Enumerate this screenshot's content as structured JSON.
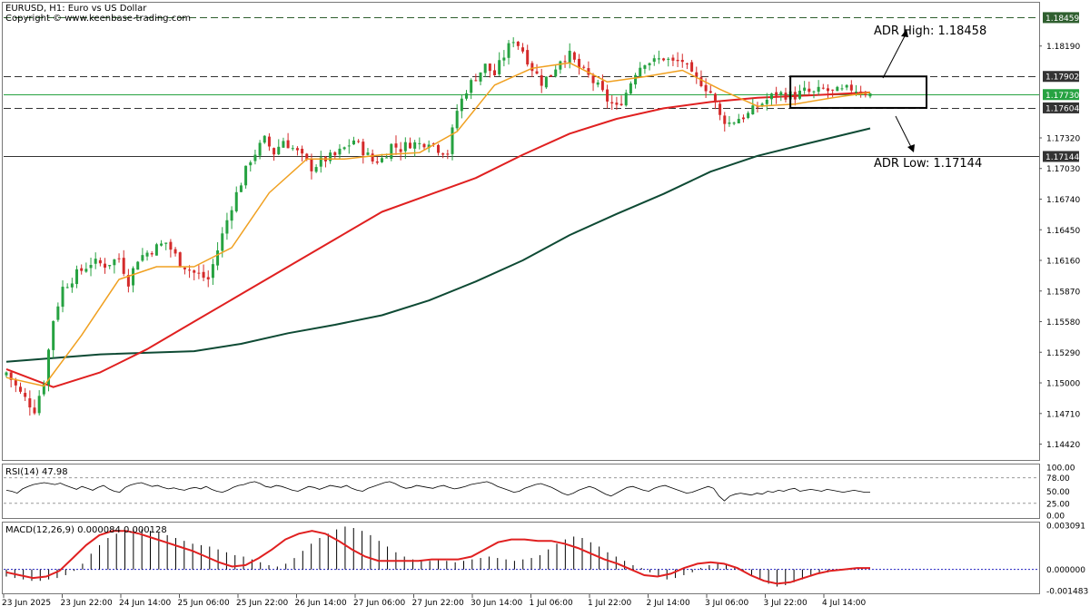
{
  "header": {
    "title": "EURUSD, H1:  Euro vs US Dollar",
    "copyright": "Copyright © www.keenbase-trading.com"
  },
  "chart_data": [
    {
      "type": "candlestick",
      "symbol": "EURUSD",
      "timeframe": "H1",
      "ylim": [
        1.1427,
        1.186
      ],
      "y_ticks": [
        "1.18190",
        "1.17320",
        "1.17030",
        "1.16740",
        "1.16450",
        "1.16160",
        "1.15870",
        "1.15580",
        "1.15290",
        "1.15000",
        "1.14710",
        "1.14420"
      ],
      "x_ticks": [
        "23 Jun 2025",
        "23 Jun 22:00",
        "24 Jun 14:00",
        "25 Jun 06:00",
        "25 Jun 22:00",
        "26 Jun 14:00",
        "27 Jun 06:00",
        "27 Jun 22:00",
        "30 Jun 14:00",
        "1 Jul 06:00",
        "1 Jul 22:00",
        "2 Jul 14:00",
        "3 Jul 06:00",
        "3 Jul 22:00",
        "4 Jul 14:00"
      ],
      "colors": {
        "up": "#26a241",
        "down": "#d42a2a",
        "sma20": "#f0a020",
        "sma100": "#e02020",
        "sma200": "#0e4a34"
      },
      "close_path": [
        [
          0,
          1.151
        ],
        [
          3,
          1.149
        ],
        [
          6,
          1.1475
        ],
        [
          8,
          1.1502
        ],
        [
          10,
          1.156
        ],
        [
          12,
          1.159
        ],
        [
          15,
          1.1603
        ],
        [
          18,
          1.1614
        ],
        [
          21,
          1.1612
        ],
        [
          24,
          1.1618
        ],
        [
          26,
          1.1596
        ],
        [
          28,
          1.1618
        ],
        [
          31,
          1.1626
        ],
        [
          34,
          1.1633
        ],
        [
          37,
          1.1614
        ],
        [
          40,
          1.1604
        ],
        [
          43,
          1.1598
        ],
        [
          46,
          1.164
        ],
        [
          48,
          1.1668
        ],
        [
          50,
          1.169
        ],
        [
          52,
          1.1712
        ],
        [
          55,
          1.173
        ],
        [
          57,
          1.1718
        ],
        [
          59,
          1.173
        ],
        [
          62,
          1.1718
        ],
        [
          65,
          1.1704
        ],
        [
          68,
          1.1712
        ],
        [
          70,
          1.1715
        ],
        [
          72,
          1.1722
        ],
        [
          74,
          1.173
        ],
        [
          76,
          1.172
        ],
        [
          78,
          1.171
        ],
        [
          80,
          1.1712
        ],
        [
          82,
          1.1725
        ],
        [
          84,
          1.1722
        ],
        [
          86,
          1.1727
        ],
        [
          88,
          1.1726
        ],
        [
          90,
          1.173
        ],
        [
          92,
          1.1722
        ],
        [
          94,
          1.1718
        ],
        [
          96,
          1.1758
        ],
        [
          98,
          1.1778
        ],
        [
          100,
          1.179
        ],
        [
          102,
          1.18
        ],
        [
          104,
          1.1792
        ],
        [
          106,
          1.181
        ],
        [
          108,
          1.1826
        ],
        [
          110,
          1.1815
        ],
        [
          112,
          1.1798
        ],
        [
          114,
          1.1785
        ],
        [
          116,
          1.1792
        ],
        [
          118,
          1.1807
        ],
        [
          120,
          1.181
        ],
        [
          122,
          1.1798
        ],
        [
          124,
          1.179
        ],
        [
          126,
          1.178
        ],
        [
          128,
          1.1768
        ],
        [
          130,
          1.176
        ],
        [
          132,
          1.1775
        ],
        [
          134,
          1.1795
        ],
        [
          136,
          1.1805
        ],
        [
          138,
          1.1804
        ],
        [
          140,
          1.1808
        ],
        [
          142,
          1.1803
        ],
        [
          144,
          1.1805
        ],
        [
          146,
          1.179
        ],
        [
          148,
          1.1785
        ],
        [
          150,
          1.1775
        ],
        [
          152,
          1.1752
        ],
        [
          154,
          1.1746
        ],
        [
          156,
          1.1751
        ],
        [
          158,
          1.1754
        ],
        [
          160,
          1.1762
        ],
        [
          162,
          1.1768
        ],
        [
          164,
          1.1774
        ],
        [
          166,
          1.1773
        ],
        [
          168,
          1.1772
        ],
        [
          170,
          1.1776
        ],
        [
          172,
          1.1774
        ],
        [
          174,
          1.1778
        ],
        [
          176,
          1.1775
        ],
        [
          178,
          1.1776
        ],
        [
          180,
          1.1779
        ],
        [
          182,
          1.1777
        ],
        [
          184,
          1.1773
        ]
      ],
      "sma20_path": [
        [
          0,
          1.1505
        ],
        [
          8,
          1.1497
        ],
        [
          16,
          1.1545
        ],
        [
          24,
          1.1598
        ],
        [
          32,
          1.161
        ],
        [
          40,
          1.161
        ],
        [
          48,
          1.1628
        ],
        [
          56,
          1.168
        ],
        [
          64,
          1.1712
        ],
        [
          72,
          1.1712
        ],
        [
          80,
          1.1716
        ],
        [
          88,
          1.1718
        ],
        [
          96,
          1.1738
        ],
        [
          104,
          1.1782
        ],
        [
          112,
          1.1798
        ],
        [
          120,
          1.1803
        ],
        [
          128,
          1.1785
        ],
        [
          136,
          1.179
        ],
        [
          144,
          1.1796
        ],
        [
          152,
          1.1778
        ],
        [
          160,
          1.1762
        ],
        [
          168,
          1.1764
        ],
        [
          176,
          1.177
        ],
        [
          184,
          1.1775
        ]
      ],
      "sma100_path": [
        [
          0,
          1.1513
        ],
        [
          10,
          1.1496
        ],
        [
          20,
          1.151
        ],
        [
          30,
          1.1532
        ],
        [
          40,
          1.1558
        ],
        [
          50,
          1.1584
        ],
        [
          60,
          1.161
        ],
        [
          70,
          1.1636
        ],
        [
          80,
          1.1662
        ],
        [
          90,
          1.1678
        ],
        [
          100,
          1.1694
        ],
        [
          110,
          1.1716
        ],
        [
          120,
          1.1736
        ],
        [
          130,
          1.175
        ],
        [
          140,
          1.176
        ],
        [
          150,
          1.1766
        ],
        [
          160,
          1.177
        ],
        [
          170,
          1.1772
        ],
        [
          184,
          1.1775
        ]
      ],
      "sma200_path": [
        [
          0,
          1.152
        ],
        [
          20,
          1.1527
        ],
        [
          40,
          1.153
        ],
        [
          50,
          1.1537
        ],
        [
          60,
          1.1547
        ],
        [
          70,
          1.1555
        ],
        [
          80,
          1.1564
        ],
        [
          90,
          1.1578
        ],
        [
          100,
          1.1596
        ],
        [
          110,
          1.1616
        ],
        [
          120,
          1.164
        ],
        [
          130,
          1.166
        ],
        [
          140,
          1.1679
        ],
        [
          150,
          1.17
        ],
        [
          160,
          1.1715
        ],
        [
          170,
          1.1726
        ],
        [
          184,
          1.1741
        ]
      ],
      "levels": [
        {
          "value": 1.18459,
          "label": "1.18459",
          "style": "dashed",
          "color": "#2f5f2f"
        },
        {
          "value": 1.17902,
          "label": "1.17902",
          "style": "dashed",
          "color": "#333333"
        },
        {
          "value": 1.1773,
          "label": "1.17730",
          "style": "solid",
          "color": "#26a241"
        },
        {
          "value": 1.17604,
          "label": "1.17604",
          "style": "dashed",
          "color": "#333333"
        },
        {
          "value": 1.17144,
          "label": "1.17144",
          "style": "solid",
          "color": "#333333"
        }
      ],
      "annotations": [
        {
          "text": "ADR High: 1.18458",
          "value": 1.18458
        },
        {
          "text": "ADR Low: 1.17144",
          "value": 1.17144
        }
      ],
      "range_box": {
        "x_from": 167,
        "x_to": 196,
        "y_low": 1.17604,
        "y_high": 1.17902
      }
    },
    {
      "type": "line",
      "name": "RSI(14)",
      "label": "RSI(14) 47.98",
      "ylim": [
        0,
        100
      ],
      "y_ticks": [
        "100.00",
        "78.00",
        "50.00",
        "25.00",
        "0.00"
      ],
      "levels": [
        78,
        25
      ],
      "series": [
        {
          "values": [
            52,
            50,
            46,
            55,
            60,
            64,
            66,
            68,
            66,
            64,
            67,
            62,
            58,
            54,
            60,
            56,
            52,
            58,
            62,
            55,
            50,
            48,
            58,
            63,
            66,
            68,
            64,
            60,
            62,
            58,
            55,
            57,
            54,
            52,
            56,
            58,
            55,
            60,
            54,
            50,
            48,
            52,
            58,
            62,
            64,
            68,
            70,
            66,
            60,
            58,
            62,
            60,
            56,
            52,
            50,
            55,
            60,
            58,
            54,
            58,
            62,
            60,
            58,
            62,
            56,
            52,
            50,
            56,
            60,
            64,
            68,
            70,
            66,
            60,
            56,
            58,
            62,
            60,
            58,
            56,
            60,
            62,
            58,
            55,
            57,
            60,
            64,
            66,
            68,
            70,
            66,
            60,
            56,
            52,
            48,
            50,
            56,
            60,
            64,
            66,
            62,
            58,
            52,
            46,
            42,
            46,
            52,
            56,
            60,
            56,
            50,
            44,
            40,
            46,
            52,
            58,
            60,
            56,
            52,
            50,
            56,
            60,
            62,
            58,
            54,
            50,
            46,
            48,
            52,
            56,
            60,
            56,
            40,
            30,
            40,
            44,
            46,
            44,
            42,
            46,
            44,
            50,
            48,
            52,
            50,
            54,
            56,
            50,
            52,
            54,
            52,
            50,
            54,
            52,
            50,
            48,
            50,
            52,
            50,
            48,
            47.98
          ]
        }
      ]
    },
    {
      "type": "bar",
      "name": "MACD(12,26,9)",
      "label": "MACD(12,26,9) 0.000084 0.000128",
      "ylim": [
        -0.001483,
        0.003091
      ],
      "y_ticks": [
        "0.003091",
        "0.000000",
        "-0.001483"
      ],
      "histogram": [
        -0.0005,
        -0.0006,
        -0.0007,
        -0.0008,
        -0.0008,
        -0.0007,
        -0.0006,
        -0.0004,
        -0.0001,
        0.0004,
        0.0011,
        0.0017,
        0.0022,
        0.0025,
        0.0027,
        0.0028,
        0.0028,
        0.0027,
        0.0026,
        0.0024,
        0.0022,
        0.002,
        0.0018,
        0.0017,
        0.0016,
        0.0014,
        0.0012,
        0.001,
        0.0009,
        0.0007,
        0.0005,
        0.0003,
        0.0002,
        0.0004,
        0.0008,
        0.0013,
        0.0018,
        0.0022,
        0.0025,
        0.0028,
        0.003,
        0.0029,
        0.0027,
        0.0024,
        0.002,
        0.0016,
        0.0012,
        0.0009,
        0.0007,
        0.0006,
        0.0006,
        0.0007,
        0.0006,
        0.0005,
        0.0006,
        0.0007,
        0.0008,
        0.0009,
        0.0008,
        0.0007,
        0.0006,
        0.0007,
        0.0008,
        0.001,
        0.0014,
        0.0018,
        0.0021,
        0.0023,
        0.0022,
        0.0019,
        0.0016,
        0.0012,
        0.0009,
        0.0006,
        0.0003,
        0.0001,
        -0.0002,
        -0.0005,
        -0.0007,
        -0.0006,
        -0.0004,
        -0.0002,
        0.0001,
        0.0003,
        0.0004,
        0.0003,
        0.0001,
        -0.0001,
        -0.0004,
        -0.0007,
        -0.001,
        -0.0012,
        -0.0011,
        -0.0009,
        -0.0007,
        -0.0005,
        -0.0003,
        -0.0002,
        -0.0001,
        0.0,
        0.0001,
        0.0001,
        0.0
      ],
      "signal": [
        -0.0002,
        -0.0004,
        -0.0006,
        -0.0005,
        -0.0001,
        0.0008,
        0.0017,
        0.0024,
        0.0027,
        0.0027,
        0.0025,
        0.0022,
        0.0019,
        0.0016,
        0.0013,
        0.0009,
        0.0005,
        0.0002,
        0.0003,
        0.0008,
        0.0014,
        0.0021,
        0.0025,
        0.0027,
        0.0025,
        0.002,
        0.0014,
        0.0009,
        0.0006,
        0.0006,
        0.0006,
        0.0006,
        0.0007,
        0.0007,
        0.0007,
        0.0009,
        0.0014,
        0.0019,
        0.0021,
        0.0021,
        0.002,
        0.002,
        0.0018,
        0.0015,
        0.0011,
        0.0007,
        0.0004,
        0.0,
        -0.0004,
        -0.0005,
        -0.0003,
        0.0001,
        0.0004,
        0.0005,
        0.0004,
        0.0001,
        -0.0004,
        -0.0008,
        -0.001,
        -0.0009,
        -0.0006,
        -0.0003,
        -0.0001,
        0.0,
        0.0001,
        0.0001
      ]
    }
  ]
}
